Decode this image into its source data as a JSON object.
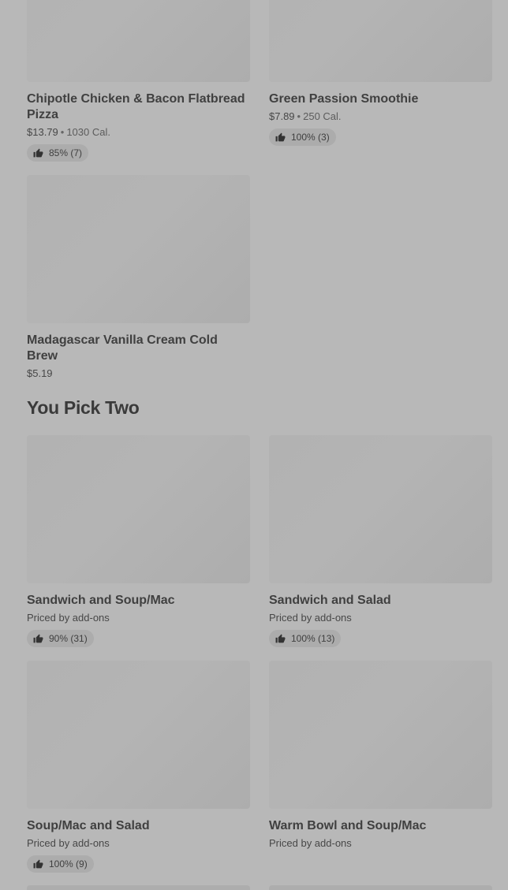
{
  "items_top": [
    {
      "name": "Chipotle Chicken & Bacon Flatbread Pizza",
      "price": "$13.79",
      "calories": "1030 Cal.",
      "rating": "85% (7)"
    },
    {
      "name": "Green Passion Smoothie",
      "price": "$7.89",
      "calories": "250 Cal.",
      "rating": "100% (3)"
    },
    {
      "name": "Madagascar Vanilla Cream Cold Brew",
      "price": "$5.19"
    }
  ],
  "section": {
    "title": "You Pick Two"
  },
  "pick_two": [
    {
      "name": "Sandwich and Soup/Mac",
      "price": "Priced by add-ons",
      "rating": "90% (31)"
    },
    {
      "name": "Sandwich and Salad",
      "price": "Priced by add-ons",
      "rating": "100% (13)"
    },
    {
      "name": "Soup/Mac and Salad",
      "price": "Priced by add-ons",
      "rating": "100% (9)"
    },
    {
      "name": "Warm Bowl and Soup/Mac",
      "price": "Priced by add-ons"
    }
  ],
  "separator": "•",
  "icons": {
    "rating": "thumbs-up-icon"
  }
}
